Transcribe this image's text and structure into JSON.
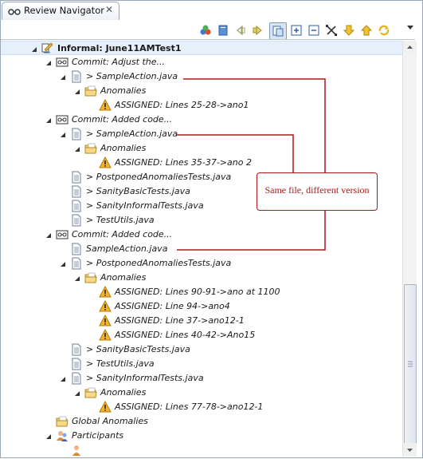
{
  "view": {
    "tab_title": "Review Navigator",
    "tab_close": "✕",
    "toolbar_icons": [
      "group-icon",
      "book-icon",
      "previous-icon",
      "next-icon",
      "link-editor-icon",
      "expand-all-icon",
      "collapse-all-icon",
      "filter-icon",
      "down-icon",
      "up-icon",
      "refresh-icon",
      "view-menu-icon"
    ]
  },
  "tree": [
    {
      "depth": 0,
      "arrow": "open",
      "icon": "review-icon",
      "label": "Informal: June11AMTest1",
      "style": "bold",
      "selected": true
    },
    {
      "depth": 1,
      "arrow": "open",
      "icon": "commit-icon",
      "label": "Commit: Adjust the...",
      "style": "it"
    },
    {
      "depth": 2,
      "arrow": "open",
      "icon": "file-icon",
      "label": "> SampleAction.java",
      "style": "it"
    },
    {
      "depth": 3,
      "arrow": "open",
      "icon": "folder-icon",
      "label": "Anomalies",
      "style": "it"
    },
    {
      "depth": 4,
      "arrow": "none",
      "icon": "warning-icon",
      "label": "ASSIGNED: Lines 25-28->ano1",
      "style": "it"
    },
    {
      "depth": 1,
      "arrow": "open",
      "icon": "commit-icon",
      "label": "Commit: Added code...",
      "style": "it"
    },
    {
      "depth": 2,
      "arrow": "open",
      "icon": "file-icon",
      "label": "> SampleAction.java",
      "style": "it"
    },
    {
      "depth": 3,
      "arrow": "open",
      "icon": "folder-icon",
      "label": "Anomalies",
      "style": "it"
    },
    {
      "depth": 4,
      "arrow": "none",
      "icon": "warning-icon",
      "label": "ASSIGNED: Lines 35-37->ano 2",
      "style": "it"
    },
    {
      "depth": 2,
      "arrow": "none",
      "icon": "file-icon",
      "label": "> PostponedAnomaliesTests.java",
      "style": "it"
    },
    {
      "depth": 2,
      "arrow": "none",
      "icon": "file-icon",
      "label": "> SanityBasicTests.java",
      "style": "it"
    },
    {
      "depth": 2,
      "arrow": "none",
      "icon": "file-icon",
      "label": "> SanityInformalTests.java",
      "style": "it"
    },
    {
      "depth": 2,
      "arrow": "none",
      "icon": "file-icon",
      "label": "> TestUtils.java",
      "style": "it"
    },
    {
      "depth": 1,
      "arrow": "open",
      "icon": "commit-icon",
      "label": "Commit: Added code...",
      "style": "it"
    },
    {
      "depth": 2,
      "arrow": "none",
      "icon": "file-icon",
      "label": "SampleAction.java",
      "style": "it"
    },
    {
      "depth": 2,
      "arrow": "open",
      "icon": "file-icon",
      "label": "> PostponedAnomaliesTests.java",
      "style": "it"
    },
    {
      "depth": 3,
      "arrow": "open",
      "icon": "folder-icon",
      "label": "Anomalies",
      "style": "it"
    },
    {
      "depth": 4,
      "arrow": "none",
      "icon": "warning-icon",
      "label": "ASSIGNED: Lines 90-91->ano at 1100",
      "style": "it"
    },
    {
      "depth": 4,
      "arrow": "none",
      "icon": "warning-icon",
      "label": "ASSIGNED: Line 94->ano4",
      "style": "it"
    },
    {
      "depth": 4,
      "arrow": "none",
      "icon": "warning-icon",
      "label": "ASSIGNED: Line 37->ano12-1",
      "style": "it"
    },
    {
      "depth": 4,
      "arrow": "none",
      "icon": "warning-icon",
      "label": "ASSIGNED: Lines 40-42->Ano15",
      "style": "it"
    },
    {
      "depth": 2,
      "arrow": "none",
      "icon": "file-icon",
      "label": "> SanityBasicTests.java",
      "style": "it"
    },
    {
      "depth": 2,
      "arrow": "none",
      "icon": "file-icon",
      "label": "> TestUtils.java",
      "style": "it"
    },
    {
      "depth": 2,
      "arrow": "open",
      "icon": "file-icon",
      "label": "> SanityInformalTests.java",
      "style": "it"
    },
    {
      "depth": 3,
      "arrow": "open",
      "icon": "folder-icon",
      "label": "Anomalies",
      "style": "it"
    },
    {
      "depth": 4,
      "arrow": "none",
      "icon": "warning-icon",
      "label": "ASSIGNED: Lines 77-78->ano12-1",
      "style": "it"
    },
    {
      "depth": 1,
      "arrow": "none",
      "icon": "folder-icon",
      "label": "Global Anomalies",
      "style": "it"
    },
    {
      "depth": 1,
      "arrow": "open",
      "icon": "participants-icon",
      "label": "Participants",
      "style": "it"
    },
    {
      "depth": 2,
      "arrow": "none",
      "icon": "person-icon",
      "label": "",
      "style": "it"
    }
  ],
  "callout": {
    "text": "Same file, different version",
    "color": "#b01818"
  }
}
